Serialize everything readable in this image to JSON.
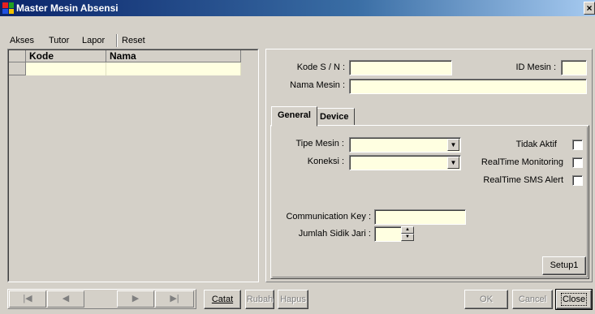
{
  "window": {
    "title": "Master Mesin Absensi",
    "close_glyph": "×"
  },
  "menu": {
    "items": [
      "Akses",
      "Tutor",
      "Lapor",
      "Reset"
    ]
  },
  "grid": {
    "columns": [
      "Kode",
      "Nama"
    ],
    "rows": [
      [
        "",
        ""
      ]
    ]
  },
  "form": {
    "kode_label": "Kode S / N :",
    "kode_value": "",
    "id_mesin_label": "ID Mesin :",
    "id_mesin_value": "",
    "nama_label": "Nama Mesin :",
    "nama_value": ""
  },
  "tabs": [
    "General",
    "Device"
  ],
  "general": {
    "tipe_label": "Tipe Mesin :",
    "tipe_value": "",
    "koneksi_label": "Koneksi :",
    "koneksi_value": "",
    "tidak_aktif_label": "Tidak Aktif",
    "realtime_monitoring_label": "RealTime Monitoring",
    "realtime_sms_label": "RealTime SMS Alert",
    "comm_key_label": "Communication Key :",
    "comm_key_value": "",
    "jumlah_label": "Jumlah Sidik Jari :",
    "jumlah_value": "",
    "setup_label": "Setup1"
  },
  "nav": {
    "first": "|◀",
    "prev": "◀",
    "next": "▶",
    "last": "▶|"
  },
  "actions": {
    "catat": "Catat",
    "rubah": "Rubah",
    "hapus": "Hapus",
    "ok": "OK",
    "cancel": "Cancel",
    "close": "Close"
  }
}
